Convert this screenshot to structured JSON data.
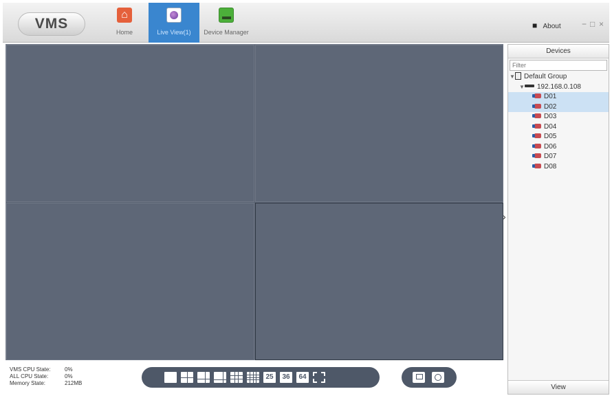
{
  "app": {
    "logo": "VMS"
  },
  "nav": [
    {
      "label": "Home",
      "icon": "home-icon"
    },
    {
      "label": "Live View(1)",
      "icon": "live-view-icon",
      "active": true
    },
    {
      "label": "Device Manager",
      "icon": "device-manager-icon"
    }
  ],
  "header": {
    "about_label": "About",
    "minimize": "−",
    "maximize": "□",
    "close": "×"
  },
  "sidebar": {
    "title": "Devices",
    "filter_placeholder": "Filter",
    "group": "Default Group",
    "device_ip": "192.168.0.108",
    "channels": [
      "D01",
      "D02",
      "D03",
      "D04",
      "D05",
      "D06",
      "D07",
      "D08"
    ],
    "selected_channels": [
      "D01",
      "D02"
    ],
    "footer": "View"
  },
  "status": {
    "vms_cpu_label": "VMS CPU State:",
    "vms_cpu_value": "0%",
    "all_cpu_label": "ALL CPU State:",
    "all_cpu_value": "0%",
    "memory_label": "Memory State:",
    "memory_value": "212MB"
  },
  "layout_toolbar": {
    "buttons": [
      "1-split",
      "4-split",
      "6-split",
      "8-split",
      "9-split",
      "16-split",
      "25",
      "36",
      "64",
      "fullscreen"
    ]
  },
  "record_toolbar": {
    "buttons": [
      "save",
      "snapshot"
    ]
  },
  "colors": {
    "active_tab": "#3a86cf",
    "grid_bg": "#5e6777",
    "toolbar_bg": "#4e5868",
    "selection": "#cce1f4"
  }
}
